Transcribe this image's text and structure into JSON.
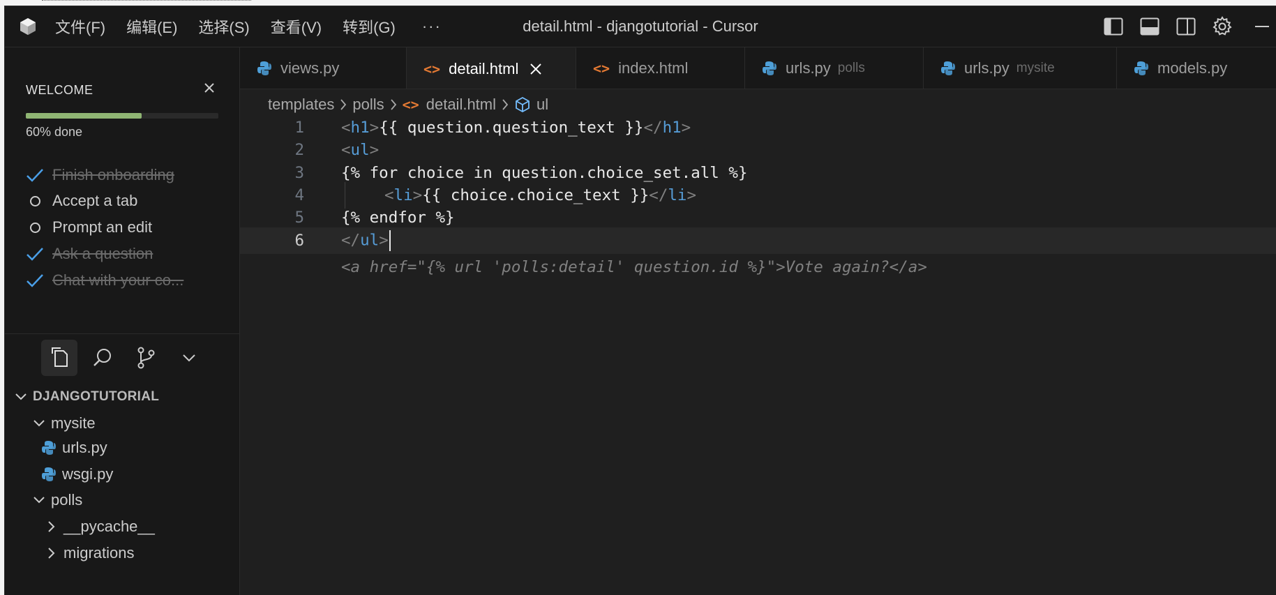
{
  "window": {
    "title": "detail.html - djangotutorial - Cursor"
  },
  "menu": [
    {
      "label": "文件(F)"
    },
    {
      "label": "编辑(E)"
    },
    {
      "label": "选择(S)"
    },
    {
      "label": "查看(V)"
    },
    {
      "label": "转到(G)"
    }
  ],
  "menu_more": "···",
  "welcome": {
    "title": "WELCOME",
    "progress_label": "60% done",
    "progress": 0.6,
    "tasks": [
      {
        "label": "Finish onboarding",
        "done": true
      },
      {
        "label": "Accept a tab",
        "done": false
      },
      {
        "label": "Prompt an edit",
        "done": false
      },
      {
        "label": "Ask a question",
        "done": true
      },
      {
        "label": "Chat with your co...",
        "done": true
      }
    ]
  },
  "explorer": {
    "section": "DJANGOTUTORIAL",
    "items": [
      {
        "label": "mysite"
      },
      {
        "label": "urls.py"
      },
      {
        "label": "wsgi.py"
      },
      {
        "label": "polls"
      },
      {
        "label": "__pycache__"
      },
      {
        "label": "migrations"
      }
    ]
  },
  "tabs": [
    {
      "label": "views.py",
      "hint": "",
      "type": "python"
    },
    {
      "label": "detail.html",
      "hint": "",
      "type": "html"
    },
    {
      "label": "index.html",
      "hint": "",
      "type": "html"
    },
    {
      "label": "urls.py",
      "hint": "polls",
      "type": "python"
    },
    {
      "label": "urls.py",
      "hint": "mysite",
      "type": "python"
    },
    {
      "label": "models.py",
      "hint": "",
      "type": "python"
    }
  ],
  "breadcrumb": {
    "parts": [
      "templates",
      "polls",
      "detail.html",
      "ul"
    ]
  },
  "editor": {
    "line_numbers": [
      "1",
      "2",
      "3",
      "4",
      "5",
      "6"
    ],
    "current_line": 6,
    "lines": {
      "l1": {
        "open": "h1",
        "body": "{{ question.question_text }}",
        "close": "h1"
      },
      "l2": {
        "open": "ul"
      },
      "l3": {
        "body": "{% for choice in question.choice_set.all %}"
      },
      "l4": {
        "open": "li",
        "body": "{{ choice.choice_text }}",
        "close": "li"
      },
      "l5": {
        "body": "{% endfor %}"
      },
      "l6": {
        "close": "ul"
      }
    },
    "ghost_suggestion": "<a href=\"{% url 'polls:detail' question.id %}\">Vote again?</a>"
  },
  "colors": {
    "accent_progress": "#8fb573",
    "check": "#4a9fe8",
    "html_icon": "#e37933",
    "python_icon": "#4e9fd8",
    "tag_name": "#569cd6"
  }
}
